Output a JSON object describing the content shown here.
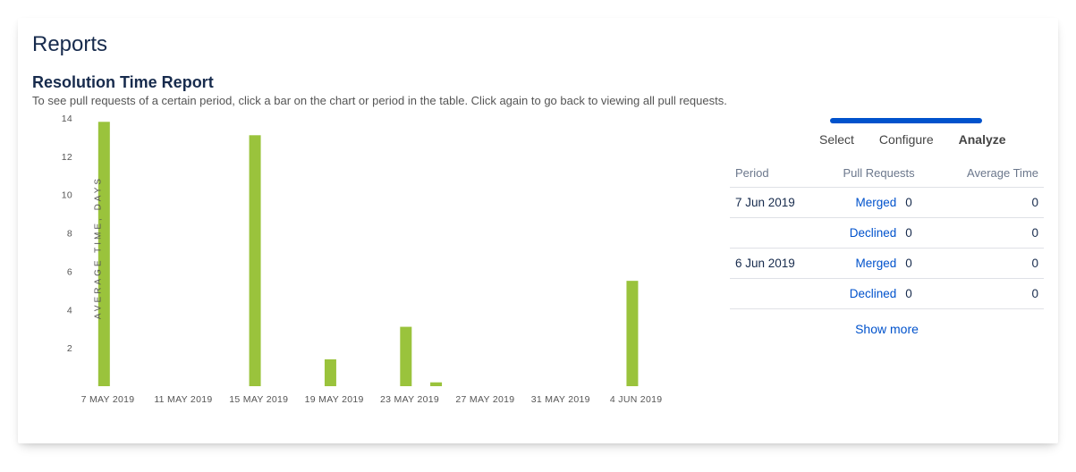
{
  "page": {
    "title": "Reports",
    "report_title": "Resolution Time Report",
    "description": "To see pull requests of a certain period, click a bar on the chart or period in the table. Click again to go back to viewing all pull requests."
  },
  "steps": {
    "select": "Select",
    "configure": "Configure",
    "analyze": "Analyze"
  },
  "table": {
    "headers": {
      "period": "Period",
      "pull_requests": "Pull Requests",
      "average_time": "Average Time"
    },
    "rows": [
      {
        "period": "7 Jun 2019",
        "status": "Merged",
        "count": "0",
        "avg": "0"
      },
      {
        "period": "",
        "status": "Declined",
        "count": "0",
        "avg": "0"
      },
      {
        "period": "6 Jun 2019",
        "status": "Merged",
        "count": "0",
        "avg": "0"
      },
      {
        "period": "",
        "status": "Declined",
        "count": "0",
        "avg": "0"
      }
    ],
    "show_more": "Show more"
  },
  "chart_data": {
    "type": "bar",
    "title": "",
    "xlabel": "",
    "ylabel": "AVERAGE TIME, DAYS",
    "ylim": [
      0,
      14
    ],
    "yticks": [
      2,
      4,
      6,
      8,
      10,
      12,
      14
    ],
    "categories": [
      "7 MAY 2019",
      "11 MAY 2019",
      "15 MAY 2019",
      "19 MAY 2019",
      "23 MAY 2019",
      "27 MAY 2019",
      "31 MAY 2019",
      "4 JUN 2019"
    ],
    "values": [
      13.8,
      0,
      13.1,
      1.4,
      3.1,
      0,
      0,
      5.5
    ],
    "extra_bars": [
      {
        "x_index": 4,
        "offset": 0.4,
        "value": 0.2
      }
    ],
    "bar_color": "#9ac33c"
  }
}
